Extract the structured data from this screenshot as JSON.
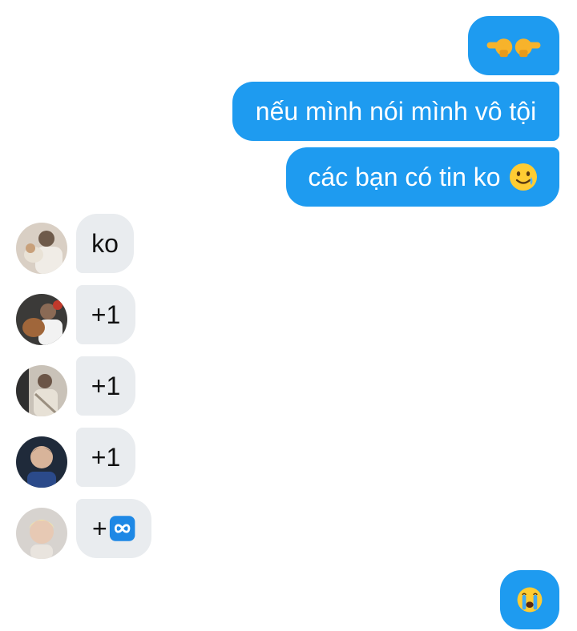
{
  "chat": {
    "outgoing": [
      {
        "id": "m1",
        "text": "",
        "emoji": "backhand-index-pointing-left-right"
      },
      {
        "id": "m2",
        "text": "nếu mình nói mình vô tội"
      },
      {
        "id": "m3",
        "text": "các bạn có tin ko",
        "emoji": "smiling-face-with-tear"
      }
    ],
    "incoming": [
      {
        "id": "r1",
        "text": "ko",
        "avatar": "friend-avatar-1"
      },
      {
        "id": "r2",
        "text": "+1",
        "avatar": "friend-avatar-2"
      },
      {
        "id": "r3",
        "text": "+1",
        "avatar": "friend-avatar-3"
      },
      {
        "id": "r4",
        "text": "+1",
        "avatar": "friend-avatar-4"
      },
      {
        "id": "r5",
        "text": "+",
        "emoji": "infinity",
        "avatar": "friend-avatar-5"
      }
    ],
    "final": {
      "id": "m4",
      "emoji": "loudly-crying-face"
    }
  },
  "colors": {
    "outgoing_bubble": "#1e9bf0",
    "incoming_bubble": "#e9ecef",
    "text_dark": "#111111",
    "text_light": "#ffffff"
  }
}
